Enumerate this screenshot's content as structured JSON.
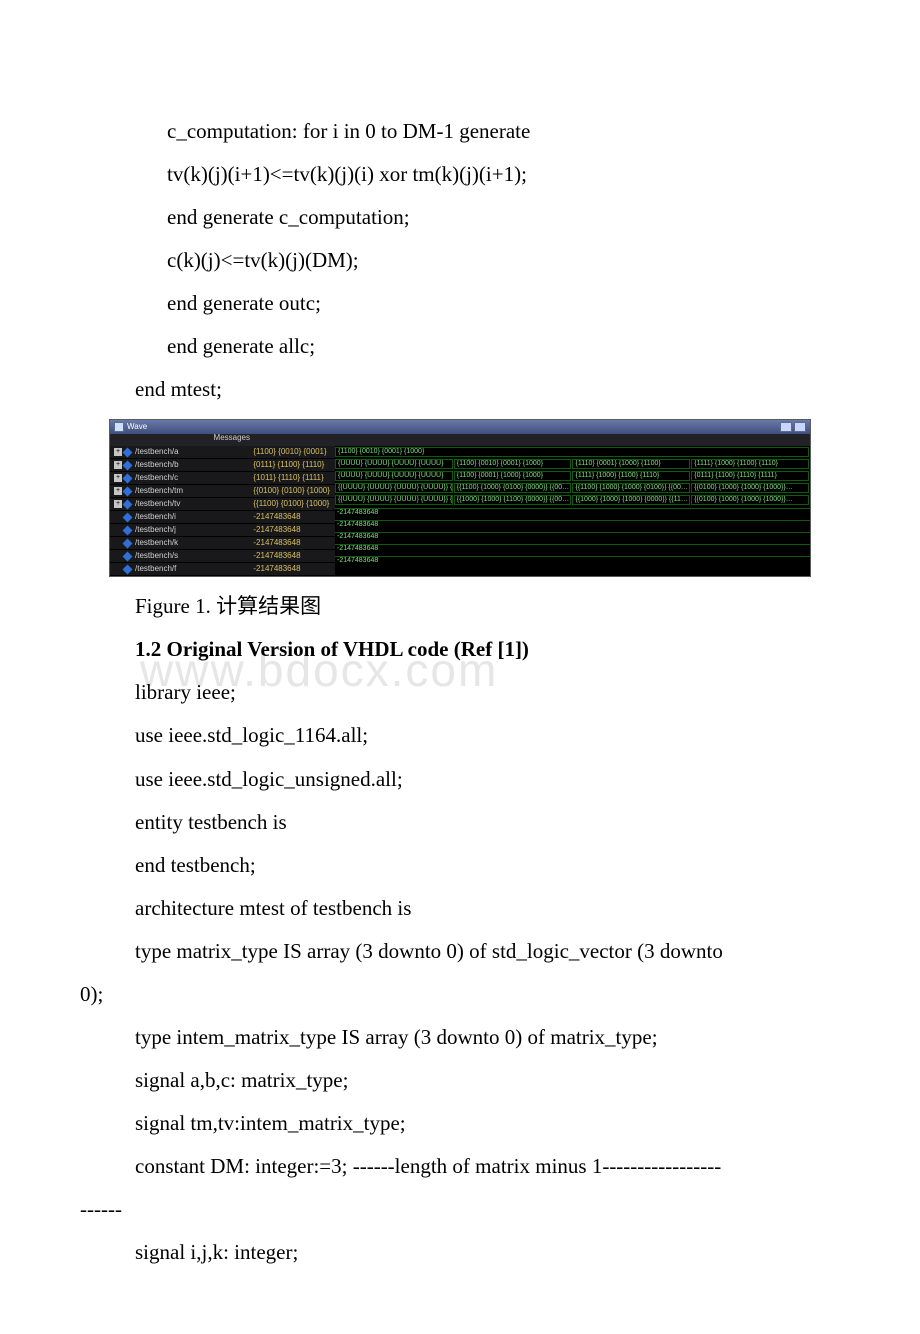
{
  "code_top": {
    "l1": "c_computation: for i in 0 to DM-1 generate",
    "l2": "tv(k)(j)(i+1)<=tv(k)(j)(i) xor tm(k)(j)(i+1);",
    "l3": "end generate c_computation;",
    "l4": "c(k)(j)<=tv(k)(j)(DM);",
    "l5": "end generate outc;",
    "l6": "end generate allc;",
    "l7": "end mtest;"
  },
  "wave": {
    "title": "Wave",
    "messages_label": "Messages",
    "signals": [
      {
        "expand": true,
        "name": "/testbench/a",
        "val": "{1100} {0010} {0001}"
      },
      {
        "expand": true,
        "name": "/testbench/b",
        "val": "{0111} {1100} {1110}"
      },
      {
        "expand": true,
        "name": "/testbench/c",
        "val": "{1011} {1110} {1111}"
      },
      {
        "expand": true,
        "name": "/testbench/tm",
        "val": "{{0100} {0100} {1000}"
      },
      {
        "expand": true,
        "name": "/testbench/tv",
        "val": "{{1100} {0100} {1000}"
      },
      {
        "expand": false,
        "name": "/testbench/i",
        "val": "-2147483648"
      },
      {
        "expand": false,
        "name": "/testbench/j",
        "val": "-2147483648"
      },
      {
        "expand": false,
        "name": "/testbench/k",
        "val": "-2147483648"
      },
      {
        "expand": false,
        "name": "/testbench/s",
        "val": "-2147483648"
      },
      {
        "expand": false,
        "name": "/testbench/f",
        "val": "-2147483648"
      }
    ],
    "wave_rows": {
      "a": [
        "{1100} {0010} {0001} {1000}"
      ],
      "b": [
        "{UUUU} {UUUU} {UUUU} {UUUU}",
        "{1100} {0010} {0001} {1000}",
        "{1110} {0001} {1000} {1100}",
        "{1111} {1000} {1100} {1110}"
      ],
      "c": [
        "{UUUU} {UUUU} {UUUU} {UUUU}",
        "{1100} {0001} {1000} {1000}",
        "{1111} {1000} {1100} {1110}",
        "{0111} {1100} {1110} {1111}"
      ],
      "tm": [
        "{{UUUU} {UUUU} {UUUU} {UUUU}} {{…",
        "{{1100} {1000} {0100} {0000}} {{00…",
        "{{1100} {1000} {1000} {0100}} {{00…",
        "{{0100} {1000} {1000} {1000}}…"
      ],
      "tv": [
        "{{UUUU} {UUUU} {UUUU} {UUUU}} {{…",
        "{{1000} {1000} {1100} {0000}} {{00…",
        "{{1000} {1000} {1000} {0000}} {{11…",
        "{{0100} {1000} {1000} {1000}}…"
      ],
      "i": "-2147483648",
      "j": "-2147483648",
      "k": "-2147483648",
      "s": "-2147483648",
      "f": "-2147483648"
    }
  },
  "caption": "Figure 1. 计算结果图",
  "section_heading": "1.2 Original Version of VHDL code  (Ref [1])",
  "code_bottom": {
    "l1": "library ieee;",
    "l2": "use ieee.std_logic_1164.all;",
    "l3": "use ieee.std_logic_unsigned.all;",
    "l4": "entity testbench is",
    "l5": "end testbench;",
    "l6": "architecture mtest of testbench is",
    "l7_lead": "type matrix_type IS array (3 downto 0) of std_logic_vector (3 downto",
    "l7_wrap": "0);",
    "l8": "type intem_matrix_type IS array (3 downto 0) of matrix_type;",
    "l9": "signal a,b,c: matrix_type;",
    "l10": "signal tm,tv:intem_matrix_type;",
    "l11_lead": "constant DM: integer:=3; ------length of matrix minus 1-----------------",
    "l11_wrap": "------",
    "l12": "signal i,j,k: integer;"
  }
}
